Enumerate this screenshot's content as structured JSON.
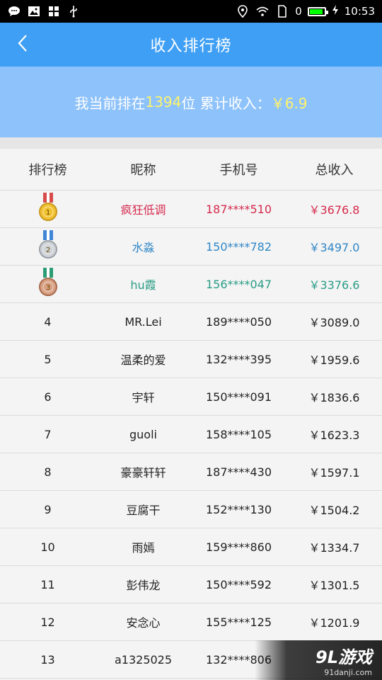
{
  "status_bar": {
    "icons_left": [
      "message-icon",
      "image-icon",
      "grid-icon",
      "usb-icon"
    ],
    "icons_right": [
      "location-icon",
      "wifi-icon",
      "sim-icon"
    ],
    "signal_text": "0",
    "battery_level": 0.9,
    "battery_color": "#00ff00",
    "time": "10:53"
  },
  "nav": {
    "back_icon": "chevron-left-icon",
    "title": "收入排行榜"
  },
  "summary": {
    "prefix": "我当前排在",
    "rank": "1394",
    "middle": "位 累计收入：",
    "amount": "￥6.9"
  },
  "table": {
    "headers": [
      "排行榜",
      "昵称",
      "手机号",
      "总收入"
    ],
    "rows": [
      {
        "rank": "1",
        "name": "疯狂低调",
        "phone": "187****510",
        "income": "￥3676.8",
        "color": "#d52a4e",
        "medal": "gold"
      },
      {
        "rank": "2",
        "name": "水淼",
        "phone": "150****782",
        "income": "￥3497.0",
        "color": "#2f86c6",
        "medal": "silver"
      },
      {
        "rank": "3",
        "name": "hu霞",
        "phone": "156****047",
        "income": "￥3376.6",
        "color": "#2a9c86",
        "medal": "bronze"
      },
      {
        "rank": "4",
        "name": "MR.Lei",
        "phone": "189****050",
        "income": "￥3089.0",
        "color": "#222222",
        "medal": ""
      },
      {
        "rank": "5",
        "name": "温柔的爱",
        "phone": "132****395",
        "income": "￥1959.6",
        "color": "#222222",
        "medal": ""
      },
      {
        "rank": "6",
        "name": "宇轩",
        "phone": "150****091",
        "income": "￥1836.6",
        "color": "#222222",
        "medal": ""
      },
      {
        "rank": "7",
        "name": "guoli",
        "phone": "158****105",
        "income": "￥1623.3",
        "color": "#222222",
        "medal": ""
      },
      {
        "rank": "8",
        "name": "豪豪轩轩",
        "phone": "187****430",
        "income": "￥1597.1",
        "color": "#222222",
        "medal": ""
      },
      {
        "rank": "9",
        "name": "豆腐干",
        "phone": "152****130",
        "income": "￥1504.2",
        "color": "#222222",
        "medal": ""
      },
      {
        "rank": "10",
        "name": "雨嫣",
        "phone": "159****860",
        "income": "￥1334.7",
        "color": "#222222",
        "medal": ""
      },
      {
        "rank": "11",
        "name": "彭伟龙",
        "phone": "150****592",
        "income": "￥1301.5",
        "color": "#222222",
        "medal": ""
      },
      {
        "rank": "12",
        "name": "安念心",
        "phone": "155****125",
        "income": "￥1201.9",
        "color": "#222222",
        "medal": ""
      },
      {
        "rank": "13",
        "name": "a1325025",
        "phone": "132****806",
        "income": "",
        "color": "#222222",
        "medal": ""
      }
    ]
  },
  "watermark": {
    "logo": "9L游戏",
    "domain": "91danji.com"
  }
}
